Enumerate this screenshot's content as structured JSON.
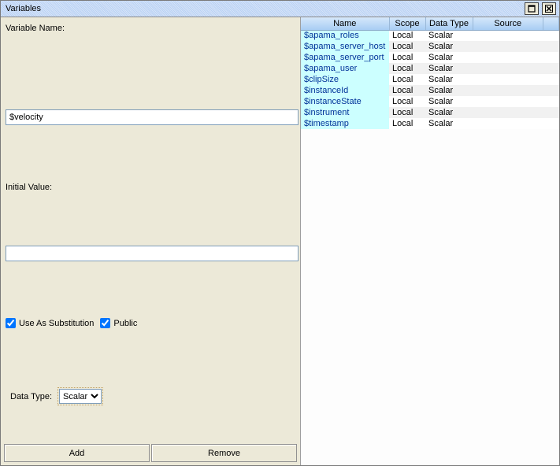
{
  "window": {
    "title": "Variables"
  },
  "form": {
    "variable_name_label": "Variable Name:",
    "variable_name_value": "$velocity",
    "initial_value_label": "Initial Value:",
    "initial_value_value": "",
    "use_as_substitution_label": "Use As Substitution",
    "use_as_substitution_checked": true,
    "public_label": "Public",
    "public_checked": true,
    "data_type_label": "Data Type:",
    "data_type_selected": "Scalar",
    "data_type_options": [
      "Scalar"
    ]
  },
  "buttons": {
    "add": "Add",
    "remove": "Remove"
  },
  "table": {
    "headers": {
      "name": "Name",
      "scope": "Scope",
      "data_type": "Data Type",
      "source": "Source"
    },
    "rows": [
      {
        "name": "$apama_roles",
        "scope": "Local",
        "data_type": "Scalar",
        "source": ""
      },
      {
        "name": "$apama_server_host",
        "scope": "Local",
        "data_type": "Scalar",
        "source": ""
      },
      {
        "name": "$apama_server_port",
        "scope": "Local",
        "data_type": "Scalar",
        "source": ""
      },
      {
        "name": "$apama_user",
        "scope": "Local",
        "data_type": "Scalar",
        "source": ""
      },
      {
        "name": "$clipSize",
        "scope": "Local",
        "data_type": "Scalar",
        "source": ""
      },
      {
        "name": "$instanceId",
        "scope": "Local",
        "data_type": "Scalar",
        "source": ""
      },
      {
        "name": "$instanceState",
        "scope": "Local",
        "data_type": "Scalar",
        "source": ""
      },
      {
        "name": "$instrument",
        "scope": "Local",
        "data_type": "Scalar",
        "source": ""
      },
      {
        "name": "$timestamp",
        "scope": "Local",
        "data_type": "Scalar",
        "source": ""
      }
    ]
  }
}
